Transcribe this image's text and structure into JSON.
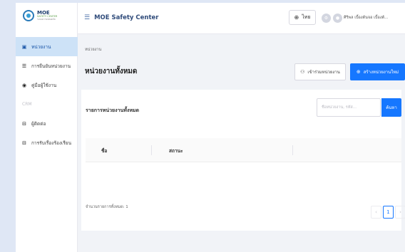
{
  "brand": {
    "name": "MOE",
    "subtitle": "SAFETY CENTER",
    "tagline": "ระบบความปลอดภัย"
  },
  "header": {
    "title": "MOE Safety Center",
    "language": "ไทย",
    "user_name": "ศิริพล เบื้องต้นจอ เบื้องต้...",
    "icons": [
      "menu-icon",
      "globe-icon",
      "settings-icon",
      "user-avatar"
    ]
  },
  "sidebar": {
    "items": [
      {
        "label": "หน่วยงาน",
        "icon": "building-icon",
        "active": true
      },
      {
        "label": "การยืนยันหน่วยงาน",
        "icon": "checklist-icon",
        "active": false
      },
      {
        "label": "คู่มือผู้ใช้งาน",
        "icon": "book-icon",
        "active": false
      },
      {
        "label": "CRM",
        "group": true
      },
      {
        "label": "ผู้ติดต่อ",
        "icon": "contact-icon",
        "active": false
      },
      {
        "label": "การรับเรื่องร้องเรียน",
        "icon": "complaint-icon",
        "active": false
      }
    ]
  },
  "breadcrumb": "หน่วยงาน",
  "page": {
    "title": "หน่วยงานทั้งหมด",
    "join_button": "เข้าร่วมหน่วยงาน",
    "create_button": "สร้างหน่วยงานใหม่"
  },
  "card": {
    "title": "รายการหน่วยงานทั้งหมด",
    "search_placeholder": "ชื่อหน่วยงาน, รหัส...",
    "search_button": "ค้นหา",
    "columns": [
      "ชื่อ",
      "สถานะ"
    ],
    "rows": [],
    "total_text": "จำนวนรายการทั้งหมด: 1",
    "pagination": {
      "current_page": "1",
      "prev": "‹",
      "next": "›"
    }
  },
  "colors": {
    "primary": "#1677ff",
    "sidebar_active_bg": "#cde2f7",
    "page_bg": "#f1f3f7",
    "outer_bg": "#dfe7f5"
  }
}
